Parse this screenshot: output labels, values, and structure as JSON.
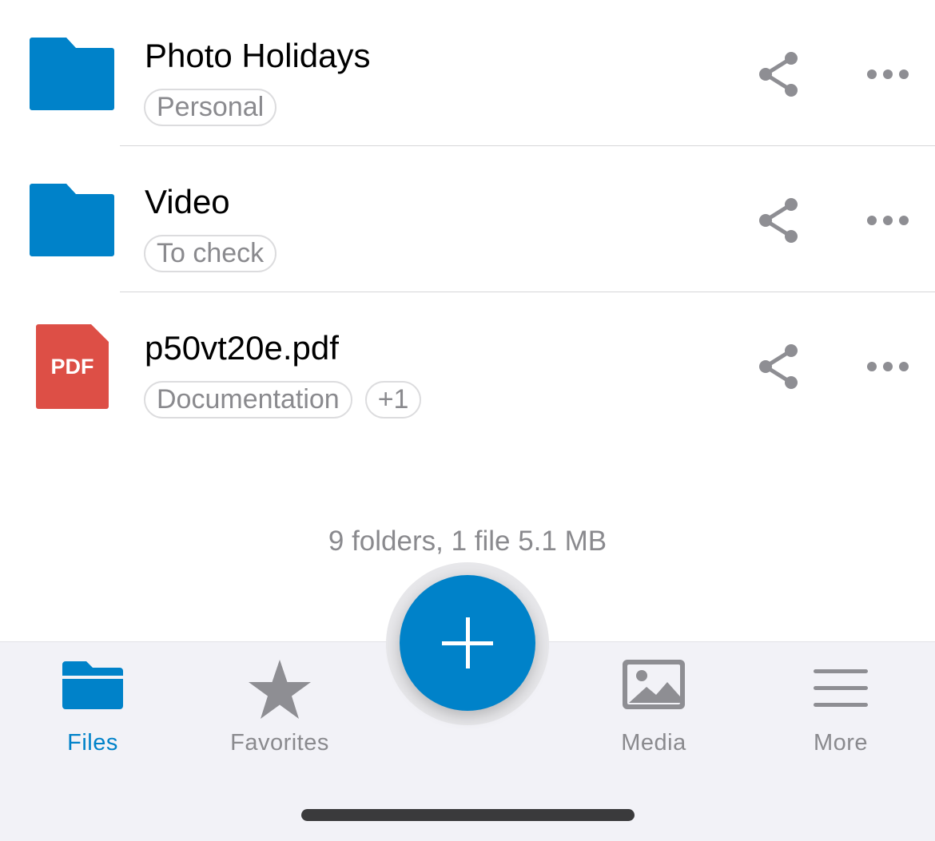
{
  "files": [
    {
      "name": "Photo Holidays",
      "kind": "folder",
      "icon": "folder-icon",
      "tags": [
        "Personal"
      ]
    },
    {
      "name": "Video",
      "kind": "folder",
      "icon": "folder-icon",
      "tags": [
        "To check"
      ]
    },
    {
      "name": "p50vt20e.pdf",
      "kind": "pdf",
      "icon": "pdf-icon",
      "icon_text": "PDF",
      "tags": [
        "Documentation",
        "+1"
      ]
    }
  ],
  "summary": "9 folders, 1 file 5.1 MB",
  "tabbar": {
    "files_label": "Files",
    "favorites_label": "Favorites",
    "media_label": "Media",
    "more_label": "More",
    "active": "Files"
  },
  "fab": {
    "icon": "plus-icon"
  },
  "colors": {
    "accent": "#0082c9",
    "pdf": "#dd4f46",
    "secondary_text": "#8a8a8e",
    "icon_gray": "#8e8e93"
  }
}
